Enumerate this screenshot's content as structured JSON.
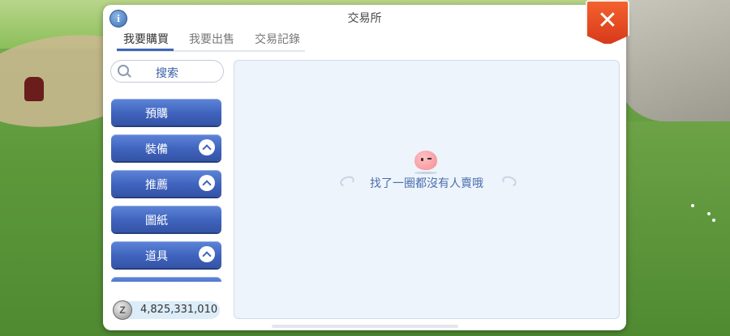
{
  "dialog": {
    "title": "交易所"
  },
  "tabs": [
    {
      "label": "我要購買",
      "active": true
    },
    {
      "label": "我要出售",
      "active": false
    },
    {
      "label": "交易記錄",
      "active": false
    }
  ],
  "search": {
    "label": "搜索"
  },
  "categories": [
    {
      "label": "預購",
      "expandable": false
    },
    {
      "label": "裝備",
      "expandable": true
    },
    {
      "label": "推薦",
      "expandable": true
    },
    {
      "label": "圖紙",
      "expandable": false
    },
    {
      "label": "道具",
      "expandable": true
    }
  ],
  "wallet": {
    "icon": "zeny-coin-icon",
    "amount": "4,825,331,010"
  },
  "empty_state": {
    "icon": "poring-icon",
    "message": "找了一圈都沒有人賣哦"
  },
  "colors": {
    "accent": "#3f63bd",
    "close": "#e4461f",
    "panel": "#eef4fb"
  }
}
